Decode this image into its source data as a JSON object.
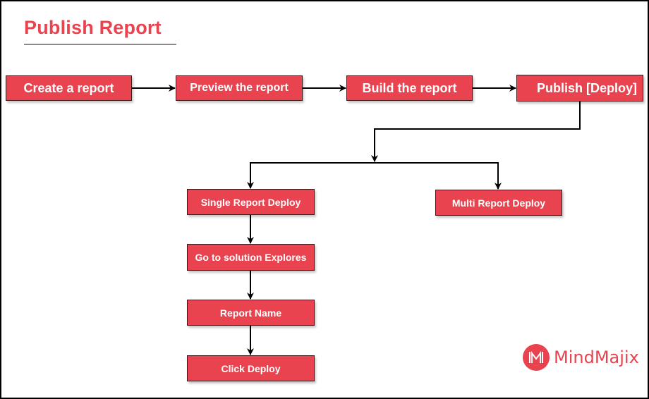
{
  "title": "Publish Report",
  "colors": {
    "box_fill": "#e8434f",
    "title": "#e8434f",
    "connector": "#000000"
  },
  "main_flow": [
    {
      "id": "create",
      "label": "Create a report"
    },
    {
      "id": "preview",
      "label": "Preview the report"
    },
    {
      "id": "build",
      "label": "Build the report"
    },
    {
      "id": "publish",
      "label": "Publish [Deploy]"
    }
  ],
  "deploy_options": [
    {
      "id": "single",
      "label": "Single Report Deploy"
    },
    {
      "id": "multi",
      "label": "Multi Report Deploy"
    }
  ],
  "single_steps": [
    {
      "id": "solution",
      "label": "Go to solution Explores"
    },
    {
      "id": "report-name",
      "label": "Report Name"
    },
    {
      "id": "click-deploy",
      "label": "Click Deploy"
    }
  ],
  "edges": [
    [
      "create",
      "preview"
    ],
    [
      "preview",
      "build"
    ],
    [
      "build",
      "publish"
    ],
    [
      "publish",
      "single"
    ],
    [
      "publish",
      "multi"
    ],
    [
      "single",
      "solution"
    ],
    [
      "solution",
      "report-name"
    ],
    [
      "report-name",
      "click-deploy"
    ]
  ],
  "logo": {
    "text": "MindMajix",
    "icon": "mindmajix-logo-icon"
  }
}
